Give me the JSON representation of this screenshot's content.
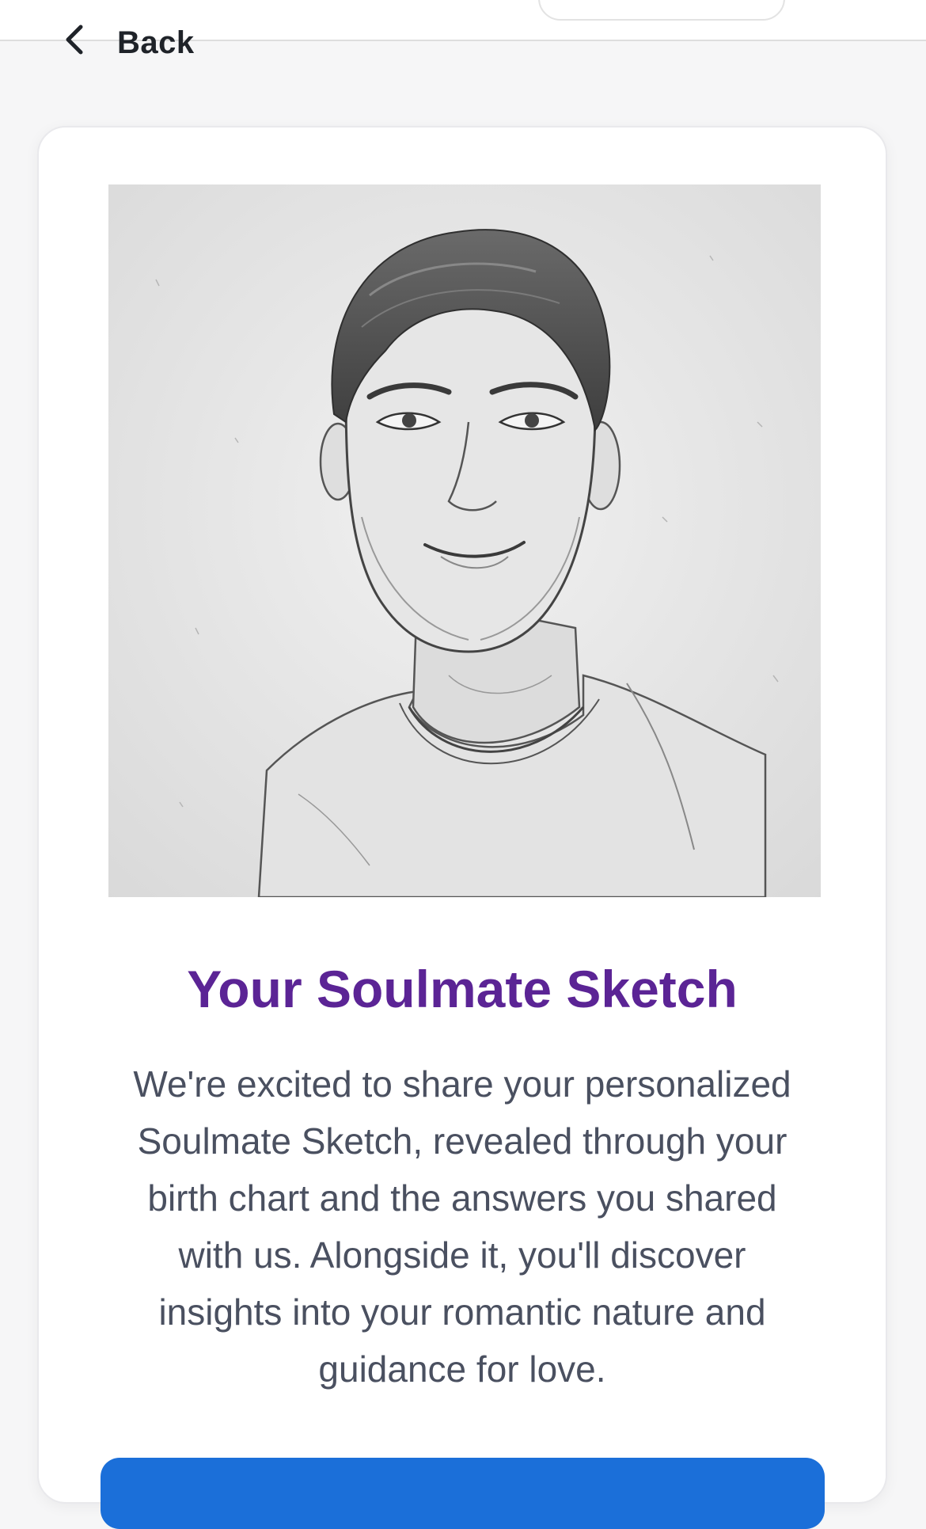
{
  "nav": {
    "back_label": "Back",
    "back_icon": "chevron-left-icon"
  },
  "result": {
    "image_alt": "Pencil sketch portrait",
    "title": "Your Soulmate Sketch",
    "description": "We're excited to share your personalized Soulmate Sketch, revealed through your birth chart and the answers you shared with us. Alongside it, you'll discover insights into your romantic nature and guidance for love."
  },
  "colors": {
    "title": "#5b2495",
    "body_text": "#4a5060",
    "button": "#1b6fd9",
    "card_background": "#ffffff",
    "page_background": "#f6f6f7"
  }
}
